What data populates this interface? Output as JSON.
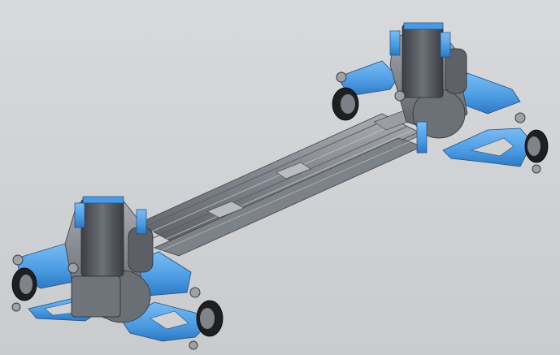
{
  "viewport": {
    "background": "#cfd1d4",
    "accent": "#4ea0e6",
    "metal": "#8a8d93",
    "dark_metal": "#4b4e54",
    "rubber": "#1e1f22"
  },
  "model": {
    "parts": [
      "rear-axle-assembly",
      "front-axle-assembly",
      "frame-rails",
      "crossmembers",
      "upper-control-arms",
      "lower-control-arms",
      "wheel-hubs",
      "ball-joints",
      "shock-absorbers"
    ]
  }
}
